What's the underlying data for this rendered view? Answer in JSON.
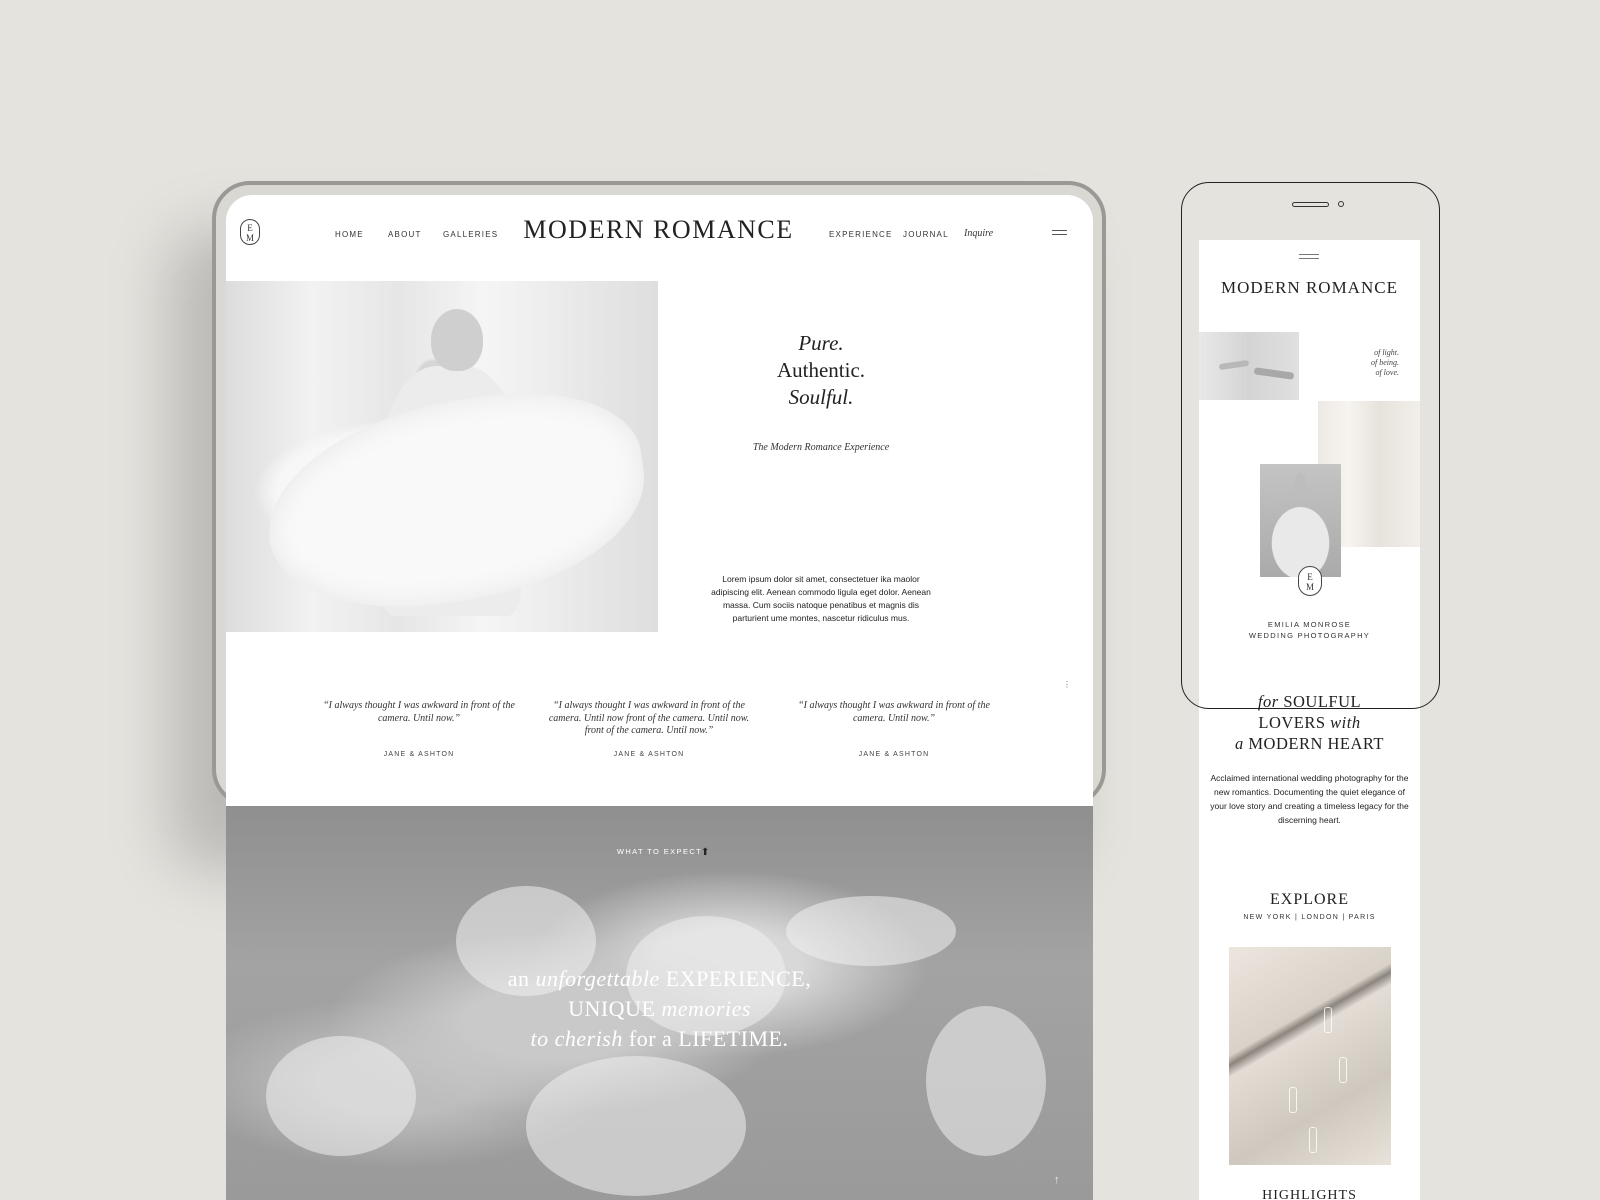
{
  "tablet": {
    "nav": {
      "monogram": "E\nM",
      "left_links": [
        "HOME",
        "ABOUT",
        "GALLERIES"
      ],
      "brand": "MODERN ROMANCE",
      "right_links": [
        "EXPERIENCE",
        "JOURNAL"
      ],
      "inquire": "Inquire"
    },
    "hero": {
      "headline_1": "Pure.",
      "headline_2": "Authentic.",
      "headline_3": "Soulful.",
      "subline": "The Modern Romance Experience",
      "body": "Lorem ipsum dolor sit amet, consectetuer ika maolor adipiscing elit. Aenean commodo ligula eget dolor. Aenean massa. Cum sociis natoque penatibus et magnis dis parturient ume montes, nascetur ridiculus mus."
    },
    "testimonials": [
      {
        "quote": "“I always thought I was awkward in front of the camera. Until now.”",
        "name": "JANE & ASHTON"
      },
      {
        "quote": "“I always thought I was awkward in front of the camera. Until now front of the camera. Until now. front of the camera. Until now.”",
        "name": "JANE & ASHTON"
      },
      {
        "quote": "“I always thought I was awkward in front of the camera. Until now.”",
        "name": "JANE & ASHTON"
      }
    ],
    "expect": {
      "label": "WHAT TO EXPECT",
      "l1_a": "an ",
      "l1_b": "unforgettable",
      "l1_c": " EXPERIENCE,",
      "l2_a": "UNIQUE ",
      "l2_b": "memories",
      "l3_a": "to cherish",
      "l3_b": " for a LIFETIME."
    }
  },
  "phone": {
    "brand": "MODERN ROMANCE",
    "light_1": "of light.",
    "light_2": "of being.",
    "light_3": "of love.",
    "monogram": "E\nM",
    "caption_1": "EMILIA MONROSE",
    "caption_2": "WEDDING PHOTOGRAPHY",
    "soulful": {
      "l1_a": "for",
      "l1_b": " SOULFUL",
      "l2_a": "LOVERS ",
      "l2_b": "with",
      "l3_a": "a",
      "l3_b": " MODERN HEART"
    },
    "description": "Acclaimed international wedding photography for the new romantics. Documenting the quiet elegance of your love story and creating a timeless legacy for the discerning heart.",
    "explore": "EXPLORE",
    "cities": "NEW YORK | LONDON | PARIS",
    "highlights": "HIGHLIGHTS"
  },
  "icons": [
    "hamburger-menu-icon",
    "monogram-logo-icon",
    "cursor-icon",
    "scroll-up-arrow-icon"
  ]
}
